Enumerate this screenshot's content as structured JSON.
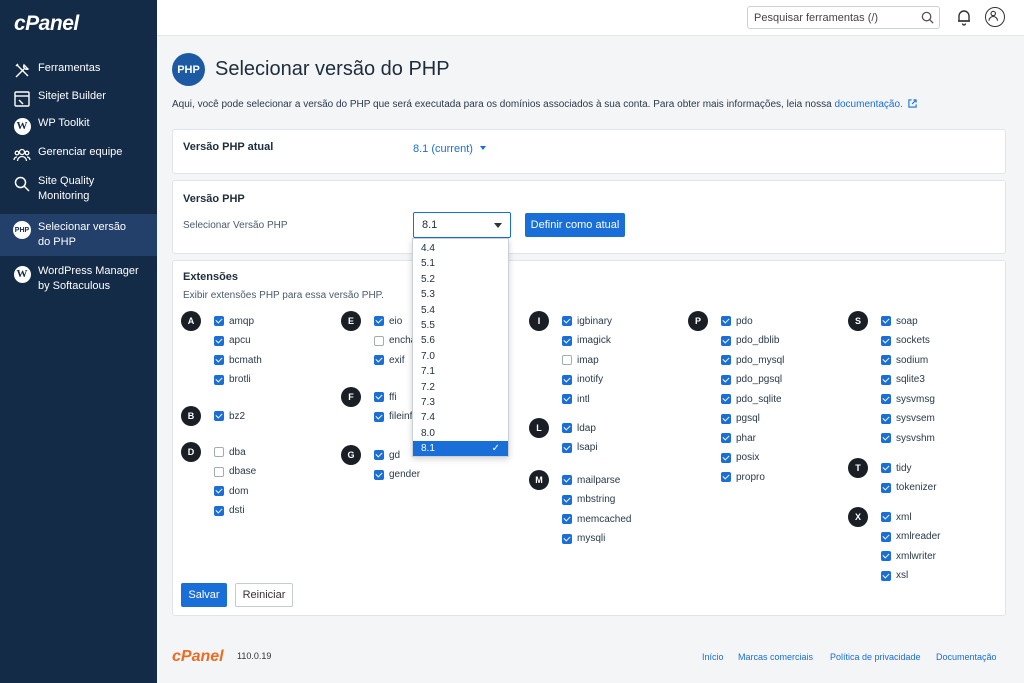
{
  "app": {
    "logo": "cPanel"
  },
  "sidebar": {
    "items": [
      {
        "label": "Ferramentas",
        "label2": ""
      },
      {
        "label": "Sitejet Builder",
        "label2": ""
      },
      {
        "label": "WP Toolkit",
        "label2": ""
      },
      {
        "label": "Gerenciar equipe",
        "label2": ""
      },
      {
        "label": "Site Quality",
        "label2": "Monitoring"
      },
      {
        "label": "Selecionar versão",
        "label2": "do PHP",
        "active": true,
        "badge": "PHP"
      },
      {
        "label": "WordPress Manager",
        "label2": "by Softaculous"
      }
    ]
  },
  "header": {
    "search_placeholder": "Pesquisar ferramentas (/)"
  },
  "page": {
    "icon_text": "PHP",
    "title": "Selecionar versão do PHP",
    "intro_text": "Aqui, você pode selecionar a versão do PHP que será executada para os domínios associados à sua conta. Para obter mais informações, leia nossa",
    "intro_link": "documentação."
  },
  "current": {
    "label": "Versão PHP atual",
    "value": "8.1 (current)"
  },
  "version": {
    "heading": "Versão PHP",
    "select_label": "Selecionar Versão PHP",
    "selected": "8.1",
    "set_button": "Definir como atual",
    "options": [
      "4.4",
      "5.1",
      "5.2",
      "5.3",
      "5.4",
      "5.5",
      "5.6",
      "7.0",
      "7.1",
      "7.2",
      "7.3",
      "7.4",
      "8.0",
      "8.1"
    ],
    "check": "✓"
  },
  "extensions": {
    "heading": "Extensões",
    "subtitle": "Exibir extensões PHP para essa versão PHP.",
    "groups": [
      {
        "letter": "A",
        "items": [
          {
            "name": "amqp",
            "checked": true
          },
          {
            "name": "apcu",
            "checked": true
          },
          {
            "name": "bcmath",
            "checked": true
          },
          {
            "name": "brotli",
            "checked": true
          }
        ]
      },
      {
        "letter": "B",
        "items": [
          {
            "name": "bz2",
            "checked": true
          }
        ]
      },
      {
        "letter": "D",
        "items": [
          {
            "name": "dba",
            "checked": false
          },
          {
            "name": "dbase",
            "checked": false
          },
          {
            "name": "dom",
            "checked": true
          },
          {
            "name": "dsti",
            "checked": true
          }
        ]
      },
      {
        "letter": "E",
        "items": [
          {
            "name": "eio",
            "checked": true
          },
          {
            "name": "enchant",
            "checked": false
          },
          {
            "name": "exif",
            "checked": true
          }
        ]
      },
      {
        "letter": "F",
        "items": [
          {
            "name": "ffi",
            "checked": true
          },
          {
            "name": "fileinfo",
            "checked": true
          }
        ]
      },
      {
        "letter": "G",
        "items": [
          {
            "name": "gd",
            "checked": true
          },
          {
            "name": "gender",
            "checked": true
          }
        ]
      },
      {
        "letter": "I",
        "items": [
          {
            "name": "igbinary",
            "checked": true
          },
          {
            "name": "imagick",
            "checked": true
          },
          {
            "name": "imap",
            "checked": false
          },
          {
            "name": "inotify",
            "checked": true
          },
          {
            "name": "intl",
            "checked": true
          }
        ]
      },
      {
        "letter": "L",
        "items": [
          {
            "name": "ldap",
            "checked": true
          },
          {
            "name": "lsapi",
            "checked": true
          }
        ]
      },
      {
        "letter": "M",
        "items": [
          {
            "name": "mailparse",
            "checked": true
          },
          {
            "name": "mbstring",
            "checked": true
          },
          {
            "name": "memcached",
            "checked": true
          },
          {
            "name": "mysqli",
            "checked": true
          }
        ]
      },
      {
        "letter": "P",
        "items": [
          {
            "name": "pdo",
            "checked": true
          },
          {
            "name": "pdo_dblib",
            "checked": true
          },
          {
            "name": "pdo_mysql",
            "checked": true
          },
          {
            "name": "pdo_pgsql",
            "checked": true
          },
          {
            "name": "pdo_sqlite",
            "checked": true
          },
          {
            "name": "pgsql",
            "checked": true
          },
          {
            "name": "phar",
            "checked": true
          },
          {
            "name": "posix",
            "checked": true
          },
          {
            "name": "propro",
            "checked": true
          }
        ]
      },
      {
        "letter": "S",
        "items": [
          {
            "name": "soap",
            "checked": true
          },
          {
            "name": "sockets",
            "checked": true
          },
          {
            "name": "sodium",
            "checked": true
          },
          {
            "name": "sqlite3",
            "checked": true
          },
          {
            "name": "sysvmsg",
            "checked": true
          },
          {
            "name": "sysvsem",
            "checked": true
          },
          {
            "name": "sysvshm",
            "checked": true
          }
        ]
      },
      {
        "letter": "T",
        "items": [
          {
            "name": "tidy",
            "checked": true
          },
          {
            "name": "tokenizer",
            "checked": true
          }
        ]
      },
      {
        "letter": "X",
        "items": [
          {
            "name": "xml",
            "checked": true
          },
          {
            "name": "xmlreader",
            "checked": true
          },
          {
            "name": "xmlwriter",
            "checked": true
          },
          {
            "name": "xsl",
            "checked": true
          }
        ]
      }
    ],
    "save_button": "Salvar",
    "reset_button": "Reiniciar"
  },
  "footer": {
    "logo": "cPanel",
    "version": "110.0.19",
    "links": [
      "Início",
      "Marcas comerciais",
      "Política de privacidade",
      "Documentação"
    ]
  },
  "colors": {
    "sidebar": "#132b47",
    "accent": "#1a6ed8",
    "footer_logo": "#ee6b20"
  }
}
